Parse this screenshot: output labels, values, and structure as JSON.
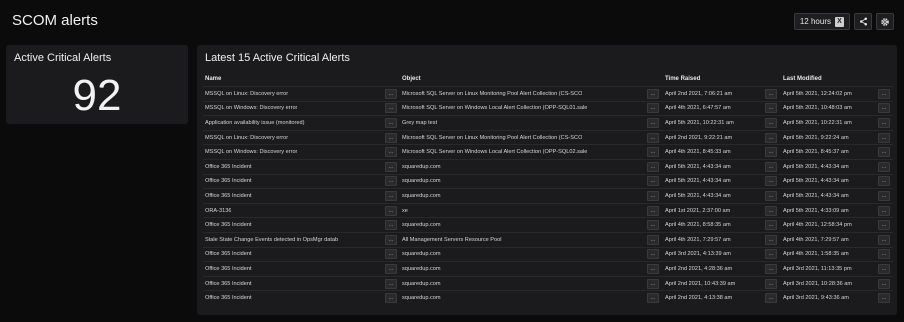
{
  "header": {
    "title": "SCOM alerts",
    "timeframe_label": "12 hours",
    "export_icon": "excel-icon",
    "share_icon": "share-icon",
    "settings_icon": "gear-icon"
  },
  "kpi": {
    "title": "Active Critical Alerts",
    "value": "92"
  },
  "table": {
    "title": "Latest 15 Active Critical Alerts",
    "columns": [
      "Name",
      "Object",
      "Time Raised",
      "Last Modified"
    ],
    "more_label": "...",
    "rows": [
      {
        "name": "MSSQL on Linux: Discovery error",
        "object": "Microsoft SQL Server on Linux Monitoring Pool Alert Collection (CS-SCO",
        "time": "April 2nd 2021, 7:06:21 am",
        "modified": "April 5th 2021, 12:24:02 pm"
      },
      {
        "name": "MSSQL on Windows: Discovery error",
        "object": "Microsoft SQL Server on Windows Local Alert Collection (OPP-SQL01.sale",
        "time": "April 4th 2021, 6:47:57 am",
        "modified": "April 5th 2021, 10:48:03 am"
      },
      {
        "name": "Application availability issue (monitored)",
        "object": "Grey map test",
        "time": "April 5th 2021, 10:22:31 am",
        "modified": "April 5th 2021, 10:22:31 am"
      },
      {
        "name": "MSSQL on Linux: Discovery error",
        "object": "Microsoft SQL Server on Linux Monitoring Pool Alert Collection (CS-SCO",
        "time": "April 2nd 2021, 9:22:21 am",
        "modified": "April 5th 2021, 9:22:24 am"
      },
      {
        "name": "MSSQL on Windows: Discovery error",
        "object": "Microsoft SQL Server on Windows Local Alert Collection (OPP-SQL02.sale",
        "time": "April 4th 2021, 8:45:33 am",
        "modified": "April 5th 2021, 8:45:37 am"
      },
      {
        "name": "Office 365 Incident",
        "object": "squaredup.com",
        "time": "April 5th 2021, 4:43:34 am",
        "modified": "April 5th 2021, 4:43:34 am"
      },
      {
        "name": "Office 365 Incident",
        "object": "squaredup.com",
        "time": "April 5th 2021, 4:43:34 am",
        "modified": "April 5th 2021, 4:43:34 am"
      },
      {
        "name": "Office 365 Incident",
        "object": "squaredup.com",
        "time": "April 5th 2021, 4:43:34 am",
        "modified": "April 5th 2021, 4:43:34 am"
      },
      {
        "name": "ORA-3136",
        "object": "xe",
        "time": "April 1st 2021, 2:37:00 am",
        "modified": "April 5th 2021, 4:33:09 am"
      },
      {
        "name": "Office 365 Incident",
        "object": "squaredup.com",
        "time": "April 4th 2021, 8:58:35 am",
        "modified": "April 4th 2021, 12:58:34 pm"
      },
      {
        "name": "Stale State Change Events detected in OpsMgr datab",
        "object": "All Management Servers Resource Pool",
        "time": "April 4th 2021, 7:29:57 am",
        "modified": "April 4th 2021, 7:29:57 am"
      },
      {
        "name": "Office 365 Incident",
        "object": "squaredup.com",
        "time": "April 3rd 2021, 4:13:39 am",
        "modified": "April 4th 2021, 1:58:35 am"
      },
      {
        "name": "Office 365 Incident",
        "object": "squaredup.com",
        "time": "April 2nd 2021, 4:28:36 am",
        "modified": "April 3rd 2021, 11:13:35 pm"
      },
      {
        "name": "Office 365 Incident",
        "object": "squaredup.com",
        "time": "April 2nd 2021, 10:43:39 am",
        "modified": "April 3rd 2021, 10:28:36 am"
      },
      {
        "name": "Office 365 Incident",
        "object": "squaredup.com",
        "time": "April 2nd 2021, 4:13:38 am",
        "modified": "April 3rd 2021, 9:43:36 am"
      }
    ]
  }
}
